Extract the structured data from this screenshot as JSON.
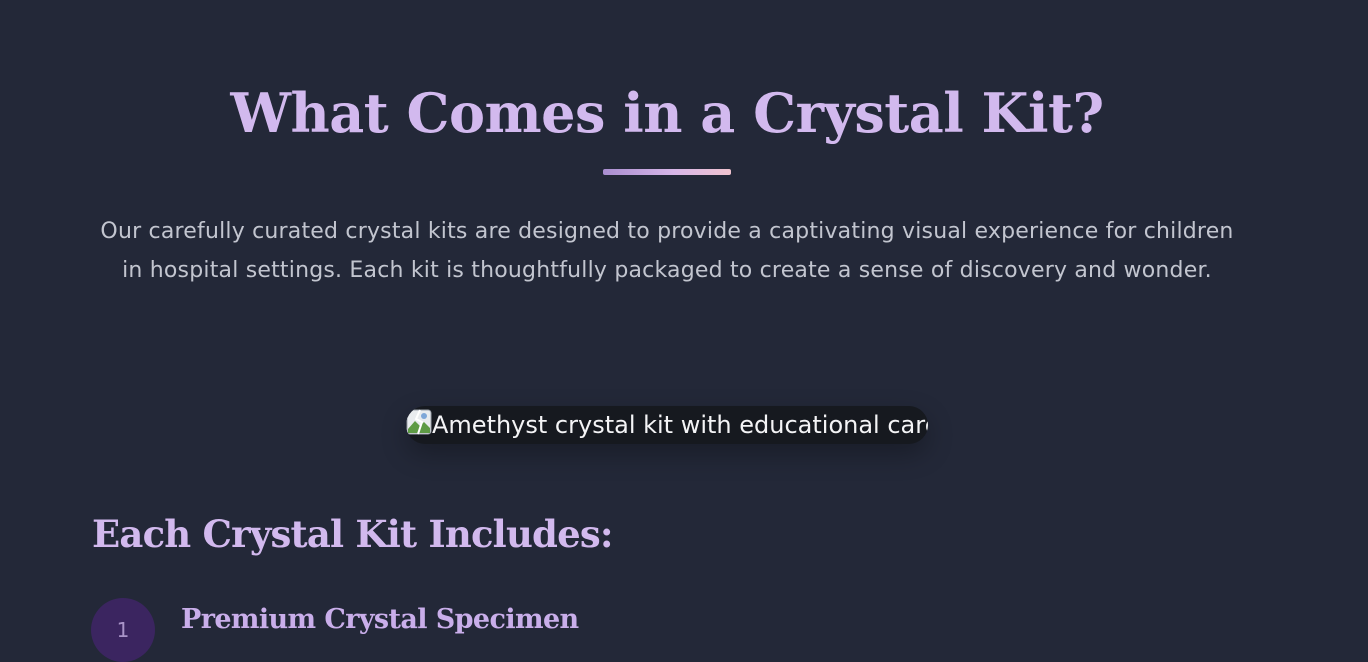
{
  "section": {
    "title": "What Comes in a Crystal Kit?",
    "intro": "Our carefully curated crystal kits are designed to provide a captivating visual experience for children in hospital settings. Each kit is thoughtfully packaged to create a sense of discovery and wonder."
  },
  "image": {
    "alt": "Amethyst crystal kit with educational card",
    "icon": "broken-image-icon"
  },
  "includes": {
    "heading": "Each Crystal Kit Includes:",
    "items": [
      {
        "number": "1",
        "title": "Premium Crystal Specimen"
      }
    ]
  },
  "colors": {
    "background": "#232838",
    "heading": "#d2b9ee",
    "body_text": "#c2c5cf",
    "badge": "#3b2560"
  }
}
